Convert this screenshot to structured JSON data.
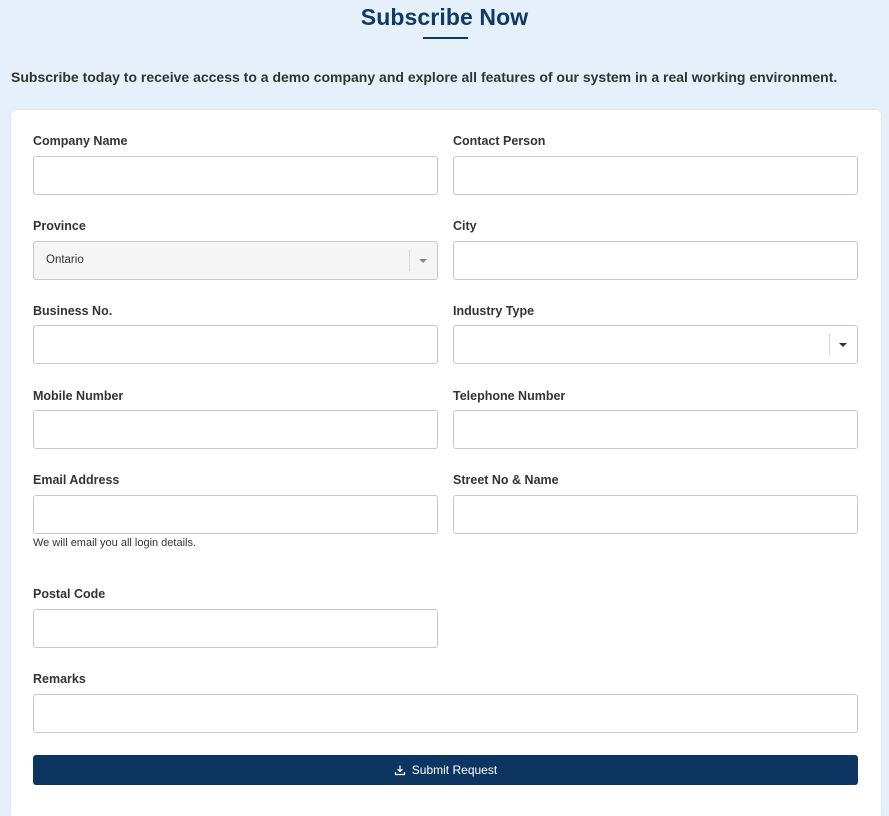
{
  "header": {
    "title": "Subscribe Now",
    "intro": "Subscribe today to receive access to a demo company and explore all features of our system in a real working environment."
  },
  "form": {
    "company_name": {
      "label": "Company Name",
      "value": ""
    },
    "contact_person": {
      "label": "Contact Person",
      "value": ""
    },
    "province": {
      "label": "Province",
      "value": "Ontario"
    },
    "city": {
      "label": "City",
      "value": ""
    },
    "business_no": {
      "label": "Business No.",
      "value": ""
    },
    "industry_type": {
      "label": "Industry Type",
      "value": ""
    },
    "mobile_number": {
      "label": "Mobile Number",
      "value": ""
    },
    "telephone_number": {
      "label": "Telephone Number",
      "value": ""
    },
    "email_address": {
      "label": "Email Address",
      "value": "",
      "help": "We will email you all login details."
    },
    "street": {
      "label": "Street No & Name",
      "value": ""
    },
    "postal_code": {
      "label": "Postal Code",
      "value": ""
    },
    "remarks": {
      "label": "Remarks",
      "value": ""
    },
    "submit_label": "Submit Request",
    "submit_icon": "download-icon"
  },
  "colors": {
    "accent": "#0d3561",
    "background": "#e6f0fa"
  }
}
